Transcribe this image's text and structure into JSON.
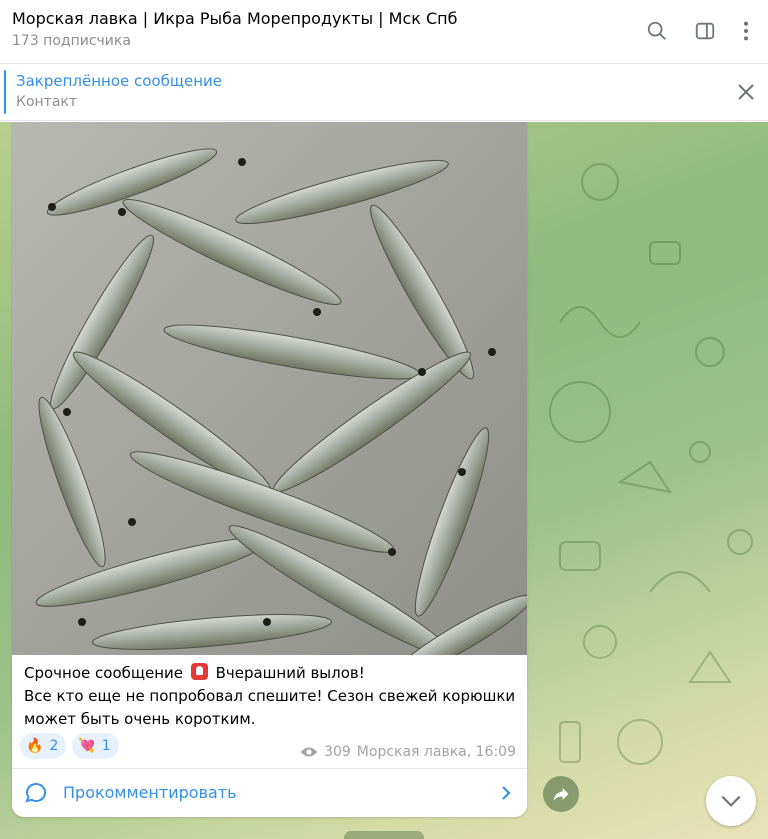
{
  "header": {
    "title": "Морская лавка | Икра Рыба Морепродукты | Мск Спб",
    "subtitle": "173 подписчика",
    "icons": [
      "search-icon",
      "sidebar-toggle-icon",
      "more-vertical-icon"
    ]
  },
  "pinned": {
    "title": "Закреплённое сообщение",
    "text": "Контакт"
  },
  "message": {
    "image_alt": "Pile of fresh smelt fish",
    "text_line1_before": "Срочное  сообщение",
    "text_line1_after": "Вчерашний вылов!",
    "text_line2": "Все кто еще не попробовал спешите! Сезон свежей корюшки",
    "text_line3": "может быть очень коротким.",
    "reactions": [
      {
        "emoji": "🔥",
        "count": "2"
      },
      {
        "emoji": "💘",
        "count": "1"
      }
    ],
    "views": "309",
    "author_time": "Морская лавка, 16:09",
    "comment_label": "Прокомментировать"
  },
  "colors": {
    "accent": "#3390ec",
    "meta": "#a3a3a3"
  }
}
